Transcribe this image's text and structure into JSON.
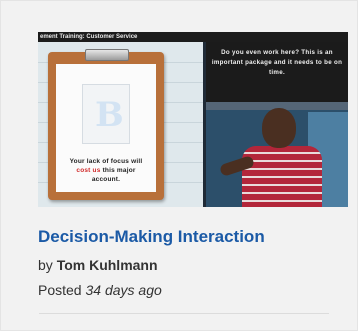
{
  "thumbnail": {
    "topbar_text": "ement Training: Customer Service",
    "clipboard_caption_before": "Your lack of focus will",
    "clipboard_caption_emph": "cost us",
    "clipboard_caption_after": "this major account.",
    "paper_glyph": "B",
    "speech_text": "Do you even work here? This is an important package and it needs to be on time."
  },
  "post": {
    "title": "Decision-Making Interaction",
    "author_prefix": "by",
    "author_name": "Tom Kuhlmann",
    "posted_prefix": "Posted",
    "posted_ago": "34 days ago"
  },
  "colors": {
    "link": "#1b5aa6",
    "emphasis": "#d12a2a",
    "card_bg": "#f2f2f2"
  }
}
